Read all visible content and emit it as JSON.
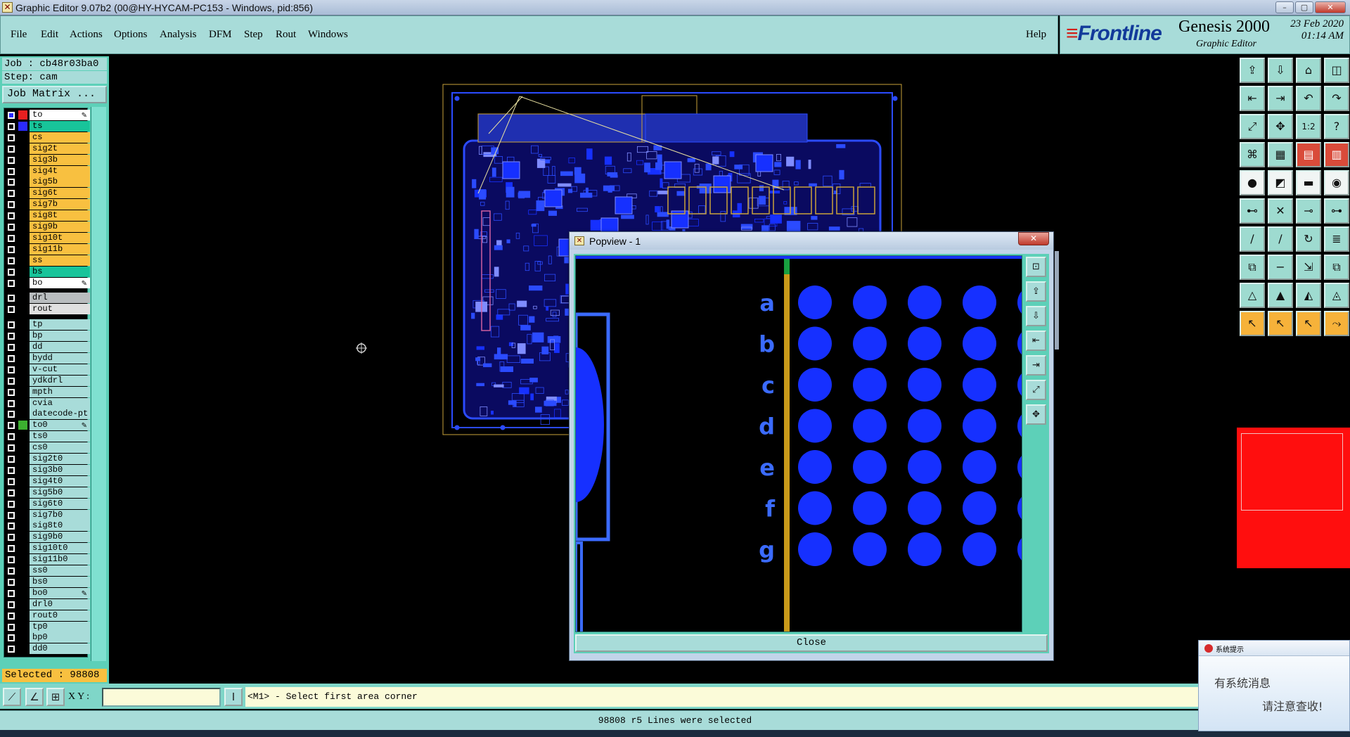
{
  "window": {
    "title": "Graphic Editor 9.07b2 (00@HY-HYCAM-PC153 - Windows, pid:856)",
    "controls": [
      "minimize",
      "maximize",
      "close"
    ]
  },
  "menu": {
    "items": [
      "File",
      "Edit",
      "Actions",
      "Options",
      "Analysis",
      "DFM",
      "Step",
      "Rout",
      "Windows"
    ],
    "help": "Help"
  },
  "brand": {
    "logo": "Frontline",
    "product": "Genesis 2000",
    "subtitle": "Graphic Editor",
    "date": "23 Feb 2020",
    "time": "01:14 AM"
  },
  "job": {
    "job_label": "Job : cb48r03ba0",
    "step_label": "Step: cam",
    "matrix_button": "Job Matrix ..."
  },
  "layers": [
    {
      "name": "to",
      "color": "#ffffff",
      "active": true,
      "edit": true
    },
    {
      "name": "ts",
      "color": "#18c49a"
    },
    {
      "name": "cs",
      "color": "#f8c040"
    },
    {
      "name": "sig2t",
      "color": "#f8c040"
    },
    {
      "name": "sig3b",
      "color": "#f8c040"
    },
    {
      "name": "sig4t",
      "color": "#f8c040"
    },
    {
      "name": "sig5b",
      "color": "#f8c040"
    },
    {
      "name": "sig6t",
      "color": "#f8c040"
    },
    {
      "name": "sig7b",
      "color": "#f8c040"
    },
    {
      "name": "sig8t",
      "color": "#f8c040"
    },
    {
      "name": "sig9b",
      "color": "#f8c040"
    },
    {
      "name": "sig10t",
      "color": "#f8c040"
    },
    {
      "name": "sig11b",
      "color": "#f8c040"
    },
    {
      "name": "ss",
      "color": "#f8c040"
    },
    {
      "name": "bs",
      "color": "#18c49a"
    },
    {
      "name": "bo",
      "color": "#ffffff",
      "edit": true
    },
    {
      "name": "drl",
      "color": "#b9bdbf",
      "gap": true
    },
    {
      "name": "rout",
      "color": "#e0e0e0"
    },
    {
      "name": "tp",
      "color": "#a8dcd9",
      "gap": true
    },
    {
      "name": "bp",
      "color": "#a8dcd9"
    },
    {
      "name": "dd",
      "color": "#a8dcd9"
    },
    {
      "name": "bydd",
      "color": "#a8dcd9"
    },
    {
      "name": "v-cut",
      "color": "#a8dcd9"
    },
    {
      "name": "ydkdrl",
      "color": "#a8dcd9"
    },
    {
      "name": "mpth",
      "color": "#a8dcd9"
    },
    {
      "name": "cvia",
      "color": "#a8dcd9"
    },
    {
      "name": "datecode-pt",
      "color": "#a8dcd9"
    },
    {
      "name": "to0",
      "color": "#a8dcd9",
      "green_mark": true,
      "edit": true
    },
    {
      "name": "ts0",
      "color": "#a8dcd9"
    },
    {
      "name": "cs0",
      "color": "#a8dcd9"
    },
    {
      "name": "sig2t0",
      "color": "#a8dcd9"
    },
    {
      "name": "sig3b0",
      "color": "#a8dcd9"
    },
    {
      "name": "sig4t0",
      "color": "#a8dcd9"
    },
    {
      "name": "sig5b0",
      "color": "#a8dcd9"
    },
    {
      "name": "sig6t0",
      "color": "#a8dcd9"
    },
    {
      "name": "sig7b0",
      "color": "#a8dcd9"
    },
    {
      "name": "sig8t0",
      "color": "#a8dcd9"
    },
    {
      "name": "sig9b0",
      "color": "#a8dcd9"
    },
    {
      "name": "sig10t0",
      "color": "#a8dcd9"
    },
    {
      "name": "sig11b0",
      "color": "#a8dcd9"
    },
    {
      "name": "ss0",
      "color": "#a8dcd9"
    },
    {
      "name": "bs0",
      "color": "#a8dcd9"
    },
    {
      "name": "bo0",
      "color": "#a8dcd9",
      "edit": true
    },
    {
      "name": "drl0",
      "color": "#a8dcd9"
    },
    {
      "name": "rout0",
      "color": "#a8dcd9"
    },
    {
      "name": "tp0",
      "color": "#a8dcd9"
    },
    {
      "name": "bp0",
      "color": "#a8dcd9"
    },
    {
      "name": "dd0",
      "color": "#a8dcd9"
    }
  ],
  "selected": "Selected : 98808",
  "toolbar": {
    "icons": [
      "open-step-icon",
      "save-icon",
      "home-icon",
      "window-split-icon",
      "zoom-left-icon",
      "zoom-right-icon",
      "pan-left-icon",
      "pan-right-icon",
      "fit-screen-icon",
      "fit-profile-icon",
      "scale-icon",
      "help-query-icon",
      "snap-icon",
      "grid-icon",
      "layer-display-icon",
      "layer-compare-icon",
      "pad-add-icon",
      "feature-info-icon",
      "measure-icon",
      "pad-icon",
      "net-icon",
      "cross-icon",
      "connect-icon",
      "disconnect-icon",
      "line-add-icon",
      "line-edit-icon",
      "arc-icon",
      "text-edit-icon",
      "surface-icon",
      "cut-icon",
      "move-icon",
      "copy-icon",
      "triangle-a-icon",
      "triangle-b-icon",
      "triangle-c-icon",
      "triangle-d-icon",
      "select-arrow-icon",
      "select-arrow-alt-icon",
      "select-point-icon",
      "route-icon"
    ]
  },
  "bottom": {
    "xy_label": "X Y :",
    "xy_value": "",
    "prompt": "<M1> - Select first area corner",
    "status": "98808 r5 Lines were selected"
  },
  "popview": {
    "title": "Popview - 1",
    "row_labels": [
      "a",
      "b",
      "c",
      "d",
      "e",
      "f",
      "g"
    ],
    "close_label": "Close",
    "close_x": "✕",
    "side_icons": [
      "zoom-window-icon",
      "zoom-in-icon",
      "zoom-out-icon",
      "pan-icon",
      "pan-right-icon",
      "fit-icon",
      "center-icon"
    ]
  },
  "notice": {
    "title": "系统提示",
    "line1": "有系统消息",
    "line2": "请注意查收!"
  }
}
